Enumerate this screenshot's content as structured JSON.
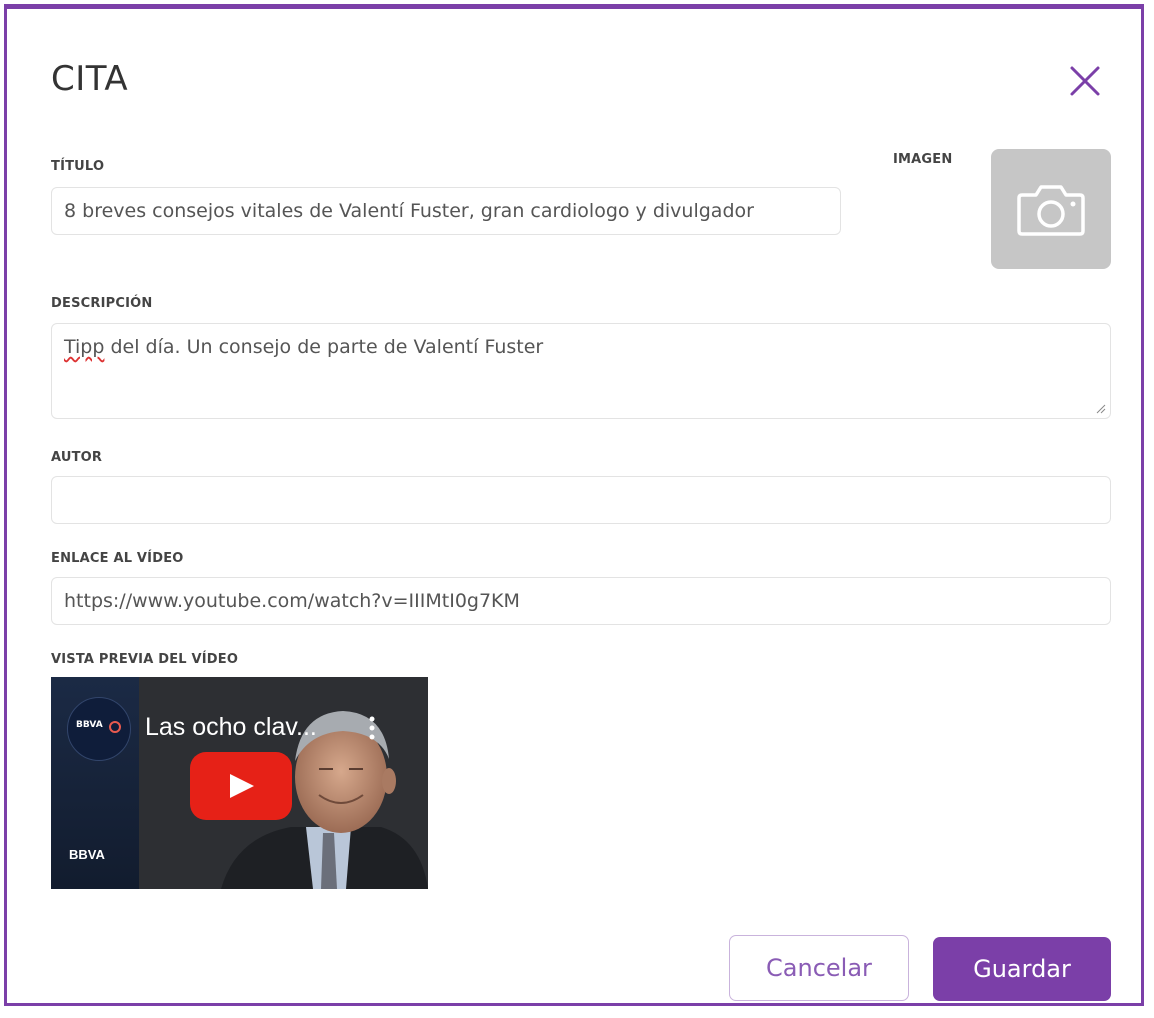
{
  "dialog": {
    "title": "CITA"
  },
  "form": {
    "titulo_label": "TÍTULO",
    "titulo_value": "8 breves consejos vitales de Valentí Fuster, gran cardiologo y divulgador",
    "imagen_label": "IMAGEN",
    "descripcion_label": "DESCRIPCIÓN",
    "descripcion_misspelled": "Tipp",
    "descripcion_rest": " del día. Un consejo de parte de Valentí Fuster",
    "autor_label": "AUTOR",
    "autor_value": "",
    "enlace_label": "ENLACE AL VÍDEO",
    "enlace_value": "https://www.youtube.com/watch?v=IIIMtI0g7KM",
    "vista_previa_label": "VISTA PREVIA DEL VÍDEO"
  },
  "video_preview": {
    "title": "Las ocho clav...",
    "channel_logo_text": "BBVA"
  },
  "buttons": {
    "cancel": "Cancelar",
    "save": "Guardar"
  },
  "colors": {
    "accent": "#7b3fa8",
    "play_button": "#e62117",
    "image_placeholder": "#c6c6c6"
  },
  "icons": {
    "close": "close-icon",
    "camera": "camera-icon",
    "play": "play-icon",
    "more": "more-vertical-icon"
  }
}
